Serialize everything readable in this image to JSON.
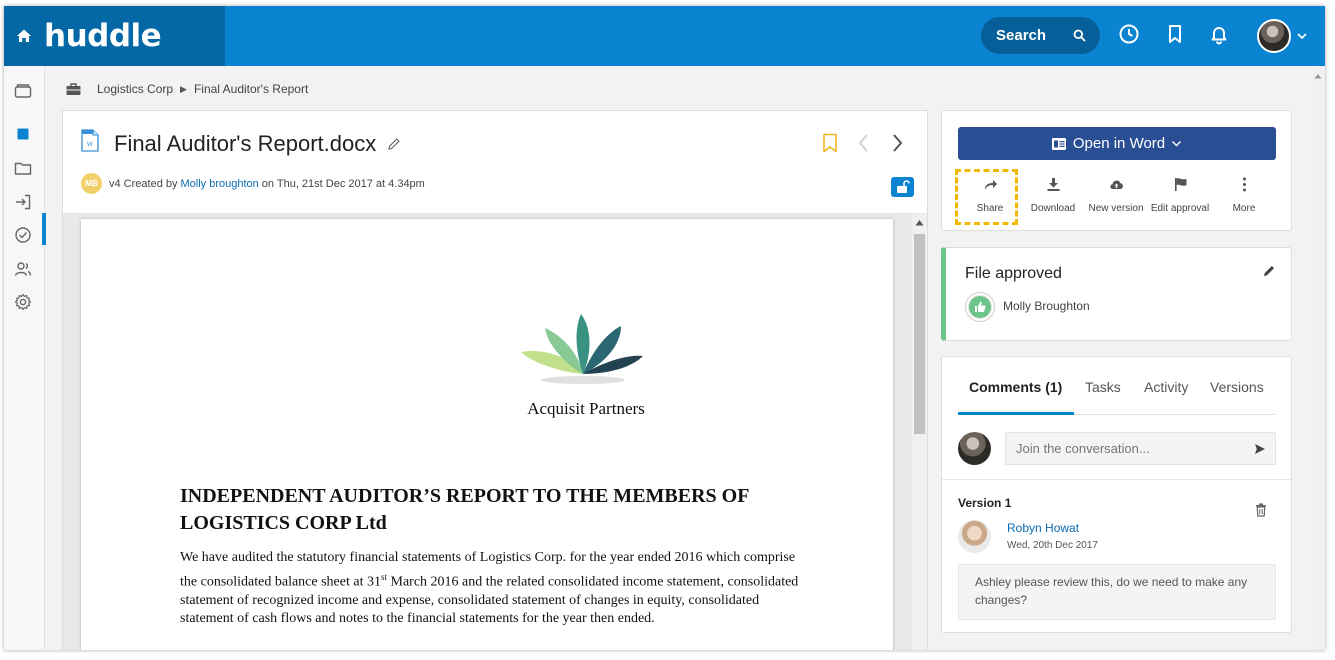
{
  "header": {
    "logo": "huddle",
    "search_label": "Search"
  },
  "breadcrumb": {
    "items": [
      "Logistics Corp",
      "Final Auditor's Report"
    ]
  },
  "document": {
    "title": "Final Auditor's Report.docx",
    "meta_prefix": "v4 Created by",
    "author": "Molly broughton",
    "meta_suffix": "on Thu, 21st Dec 2017 at 4.34pm",
    "author_initials": "MB",
    "company": "Acquisit Partners",
    "report_title": "INDEPENDENT AUDITOR’S REPORT TO THE MEMBERS OF LOGISTICS CORP Ltd",
    "body_1": "We have audited the statutory financial statements of Logistics Corp. for the year ended 2016 which comprise the consolidated balance sheet at 31",
    "body_sup": "st",
    "body_2": " March 2016 and the related consolidated income statement, consolidated statement of recognized income and expense, consolidated statement of changes in equity, consolidated statement of cash flows and notes to the financial statements for the year then ended."
  },
  "actions": {
    "open_word_label": "Open in Word",
    "items": [
      {
        "label": "Share",
        "icon": "share-icon"
      },
      {
        "label": "Download",
        "icon": "download-icon"
      },
      {
        "label": "New version",
        "icon": "cloud-upload-icon"
      },
      {
        "label": "Edit approval",
        "icon": "flag-icon"
      },
      {
        "label": "More",
        "icon": "more-vertical-icon"
      }
    ]
  },
  "approval": {
    "title": "File approved",
    "approver": "Molly Broughton"
  },
  "comments": {
    "tabs": [
      "Comments (1)",
      "Tasks",
      "Activity",
      "Versions"
    ],
    "placeholder": "Join the conversation...",
    "version_label": "Version 1",
    "commenter": "Robyn Howat",
    "date": "Wed, 20th Dec 2017",
    "text": "Ashley please review this, do we need to make any changes?"
  },
  "colors": {
    "brand_blue": "#0a84d0",
    "brand_dark": "#0568a6",
    "word_button": "#2a4e93",
    "approved_green": "#6cc58a",
    "highlight": "#f2b800"
  }
}
